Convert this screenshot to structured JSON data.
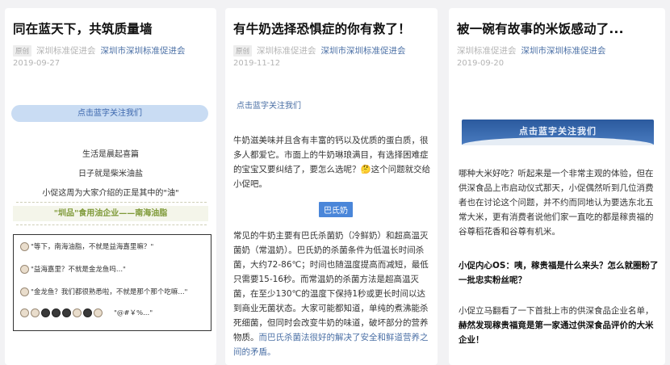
{
  "cards": [
    {
      "title": "同在蓝天下，共筑质量墙",
      "tag": "原创",
      "author": "深圳标准促进会",
      "org": "深圳市深圳标准促进会",
      "date": "2019-09-27",
      "follow_banner": "点击蓝字关注我们",
      "lines": [
        "生活是晨起喜篇",
        "日子就是柴米油盐",
        "小促这周为大家介绍的正是其中的\"油\""
      ],
      "highlight": "\"圳品\"食用油企业——南海油脂",
      "chat": [
        "\"等下，南海油脂，不就是益海嘉里嘛？\"",
        "\"益海嘉里？不就是金龙鱼吗...\"",
        "\"金龙鱼？我们都很熟悉啦，不就是那个那个吃嘛...\"",
        "\"@#￥%...\""
      ]
    },
    {
      "title": "有牛奶选择恐惧症的你有救了！",
      "tag": "原创",
      "author": "深圳标准促进会",
      "org": "深圳市深圳标准促进会",
      "date": "2019-11-12",
      "follow_link": "点击蓝字关注我们",
      "para1": "牛奶滋美味并且含有丰富的钙以及优质的蛋白质，很多人都爱它。市面上的牛奶琳琅满目，有选择困难症的宝宝又要纠结了，要怎么选呢？🤔这个问题就交给小促吧。",
      "section_tag": "巴氏奶",
      "para2": "常见的牛奶主要有巴氏杀菌奶（冷鲜奶）和超高温灭菌奶（常温奶）。巴氏奶的杀菌条件为低温长时间杀菌，大约72-86℃；时间也随温度提高而减短，最低只需要15-16秒。而常温奶的杀菌方法是超高温灭菌，在至少130℃的温度下保持1秒或更长时间以达到商业无菌状态。大家可能都知道，单纯的煮沸能杀死细菌，但同时会改变牛奶的味道，破坏部分的营养物质。",
      "para2_link": "而巴氏杀菌法很好的解决了安全和鲜道营养之间的矛盾。"
    },
    {
      "title": "被一碗有故事的米饭感动了...",
      "author": "深圳标准促进会",
      "org": "深圳市深圳标准促进会",
      "date": "2019-09-20",
      "follow_banner": "点击蓝字关注我们",
      "para1": "哪种大米好吃？听起来是一个非常主观的体验，但在供深食品上市启动仪式那天，小促偶然听到几位消费者也在讨论这个问题，并不约而同地认为要选东北五常大米，更有消费者说他们家一直吃的都是稼贵福的谷尊稻花香和谷尊有机米。",
      "para2": "小促内心OS：咦，稼贵福是什么来头？怎么就圈粉了一批忠实粉丝呢？",
      "para3_a": "小促立马翻看了一下首批上市的供深食品企业名单，",
      "para3_b": "赫然发现稼贵福竟是第一家通过供深食品评价的大米企业！"
    }
  ]
}
